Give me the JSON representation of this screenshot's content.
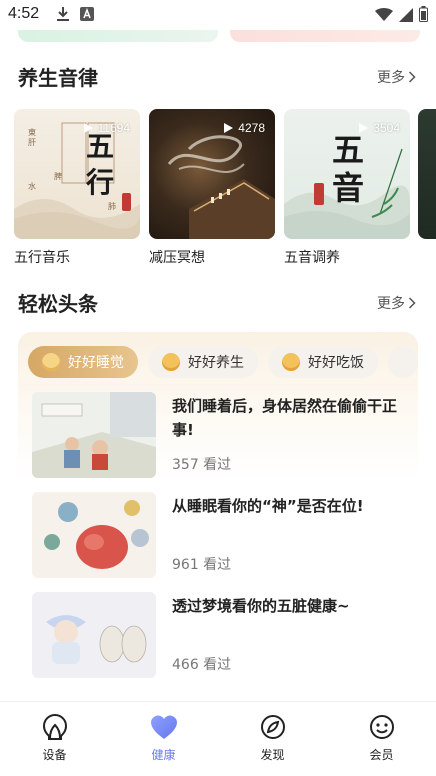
{
  "status_bar": {
    "time": "4:52"
  },
  "music_section": {
    "title": "养生音律",
    "more": "更多",
    "items": [
      {
        "label": "五行音乐",
        "count": "11694",
        "art_text": "五行"
      },
      {
        "label": "减压冥想",
        "count": "4278"
      },
      {
        "label": "五音调养",
        "count": "3504",
        "art_text": "五音"
      }
    ]
  },
  "news_section": {
    "title": "轻松头条",
    "more": "更多",
    "tabs": [
      {
        "label": "好好睡觉",
        "active": true
      },
      {
        "label": "好好养生",
        "active": false
      },
      {
        "label": "好好吃饭",
        "active": false
      }
    ],
    "articles": [
      {
        "title": "我们睡着后，身体居然在偷偷干正事!",
        "views": "357 看过"
      },
      {
        "title": "从睡眠看你的“神”是否在位!",
        "views": "961 看过"
      },
      {
        "title": "透过梦境看你的五脏健康~",
        "views": "466 看过"
      }
    ]
  },
  "bottom_nav": {
    "items": [
      {
        "label": "设备",
        "icon": "device-icon"
      },
      {
        "label": "健康",
        "icon": "heart-icon",
        "active": true
      },
      {
        "label": "发现",
        "icon": "compass-icon"
      },
      {
        "label": "会员",
        "icon": "smiley-icon"
      }
    ]
  },
  "colors": {
    "accent": "#6a7cf0",
    "tab_active": "#d6a765"
  }
}
